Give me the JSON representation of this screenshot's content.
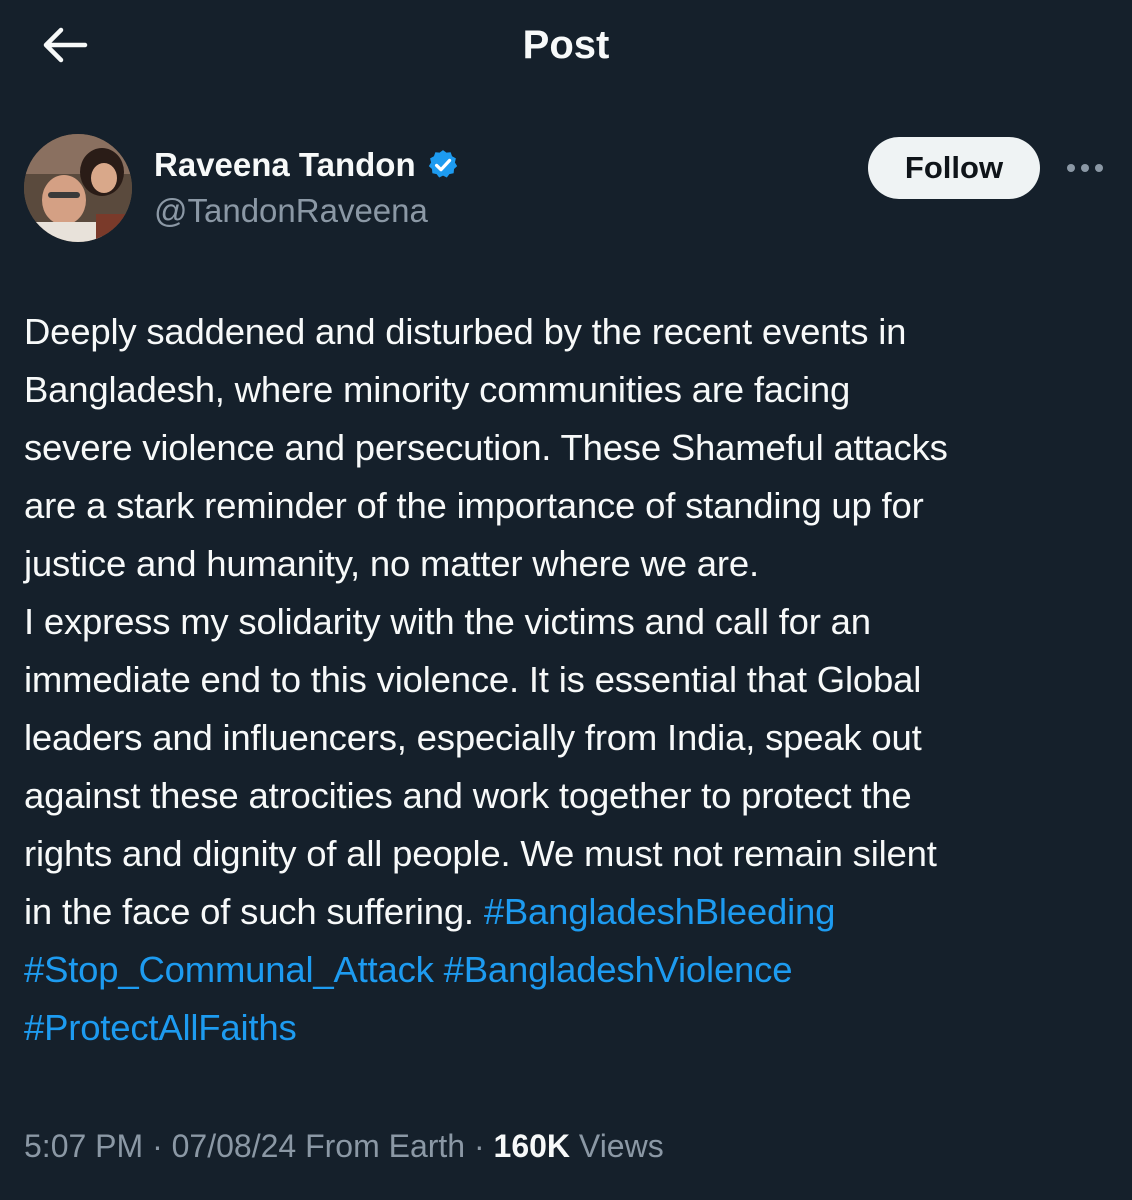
{
  "header": {
    "title": "Post"
  },
  "author": {
    "name": "Raveena Tandon",
    "handle": "@TandonRaveena",
    "verified": true
  },
  "actions": {
    "follow_label": "Follow"
  },
  "post": {
    "lines": [
      "Deeply saddened and disturbed by the recent events in",
      "Bangladesh, where minority communities are facing",
      "severe violence and persecution. These Shameful attacks",
      "are a stark reminder of the importance of standing up for",
      "justice and humanity, no matter where we are.",
      "I express my solidarity with the victims and call for an",
      "immediate end to this violence. It is essential that Global",
      "leaders and influencers, especially from India, speak out",
      "against these atrocities and work together to protect the",
      "rights and dignity of all people. We must not remain silent"
    ],
    "last_line_text": "in the face of such suffering. ",
    "hashtags": [
      "#BangladeshBleeding",
      "#Stop_Communal_Attack",
      "#BangladeshViolence",
      "#ProtectAllFaiths"
    ]
  },
  "meta": {
    "time": "5:07 PM",
    "date": "07/08/24",
    "source": "From Earth",
    "separator": "·",
    "views_count": "160K",
    "views_label": "Views"
  },
  "colors": {
    "background": "#15202b",
    "accent": "#1d9bf0",
    "muted": "#8b98a5",
    "text": "#f7f9f9"
  },
  "icons": [
    "back-arrow-icon",
    "verified-badge-icon",
    "more-icon"
  ]
}
